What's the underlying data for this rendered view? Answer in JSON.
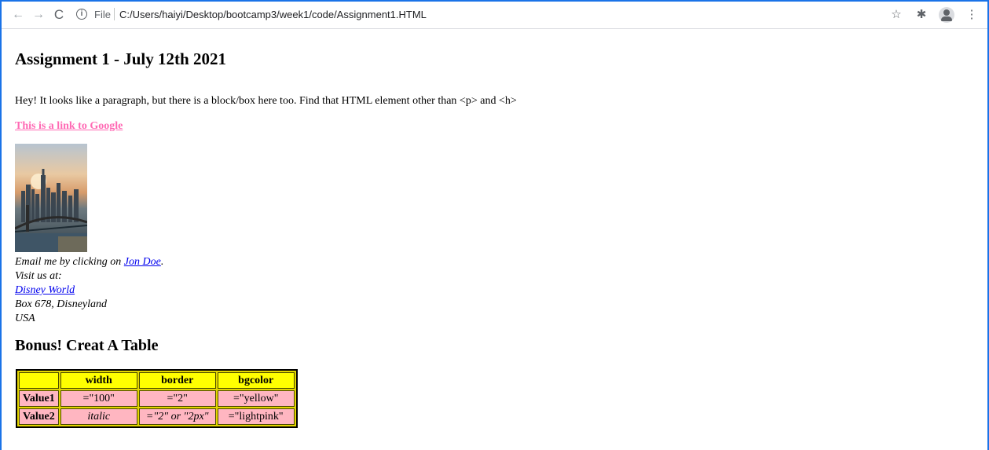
{
  "browser": {
    "back_icon": "←",
    "forward_icon": "→",
    "reload_icon": "C",
    "info_icon": "i",
    "file_label": "File",
    "url": "C:/Users/haiyi/Desktop/bootcamp3/week1/code/Assignment1.HTML",
    "star_icon": "☆",
    "extensions_icon": "✱",
    "menu_icon": "⋮"
  },
  "page": {
    "title": "Assignment 1 - July 12th 2021",
    "intro": "Hey! It looks like a paragraph, but there is a block/box here too. Find that HTML element other than <p> and <h>",
    "google_link": "This is a link to Google",
    "address": {
      "email_prefix": "Email me by clicking on ",
      "email_link": "Jon Doe",
      "email_suffix": ".",
      "visit": "Visit us at:",
      "disney_link": "Disney World",
      "box": "Box 678, Disneyland",
      "country": "USA"
    },
    "table_title": "Bonus! Creat A Table",
    "table": {
      "headers": [
        "",
        "width",
        "border",
        "bgcolor"
      ],
      "rows": [
        [
          "Value1",
          "=\"100\"",
          "=\"2\"",
          "=\"yellow\""
        ],
        [
          "Value2",
          "italic",
          "=\"2\" or \"2px\"",
          "=\"lightpink\""
        ]
      ]
    }
  }
}
